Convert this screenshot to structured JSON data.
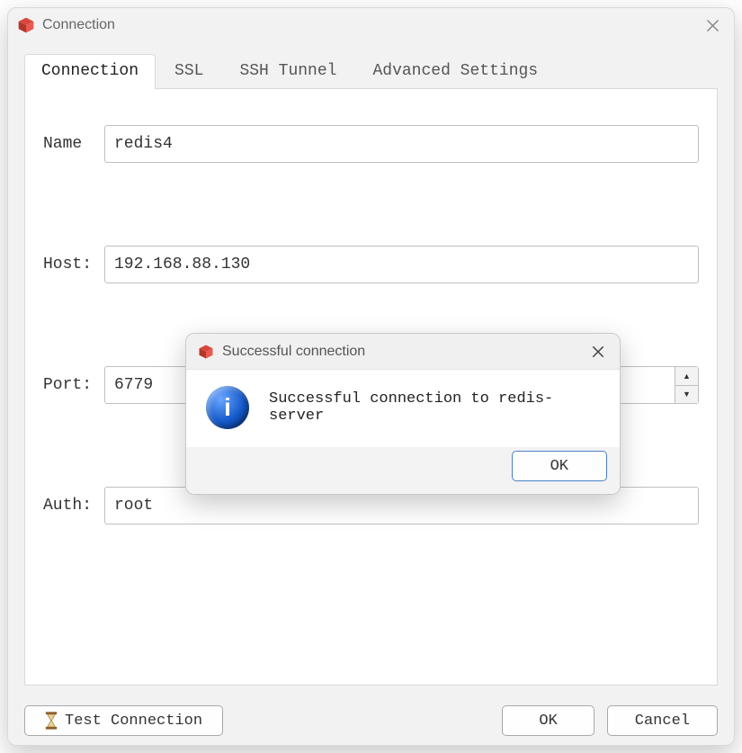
{
  "window": {
    "title": "Connection",
    "icon_name": "redis-cube-icon"
  },
  "tabs": [
    {
      "label": "Connection",
      "active": true
    },
    {
      "label": "SSL",
      "active": false
    },
    {
      "label": "SSH Tunnel",
      "active": false
    },
    {
      "label": "Advanced Settings",
      "active": false
    }
  ],
  "form": {
    "name_label": "Name",
    "name_value": "redis4",
    "host_label": "Host:",
    "host_value": "192.168.88.130",
    "port_label": "Port:",
    "port_value": "6779",
    "auth_label": "Auth:",
    "auth_value": "root"
  },
  "footer": {
    "test_connection": "Test Connection",
    "ok": "OK",
    "cancel": "Cancel"
  },
  "modal": {
    "title": "Successful connection",
    "message": "Successful connection to redis-server",
    "ok": "OK"
  }
}
